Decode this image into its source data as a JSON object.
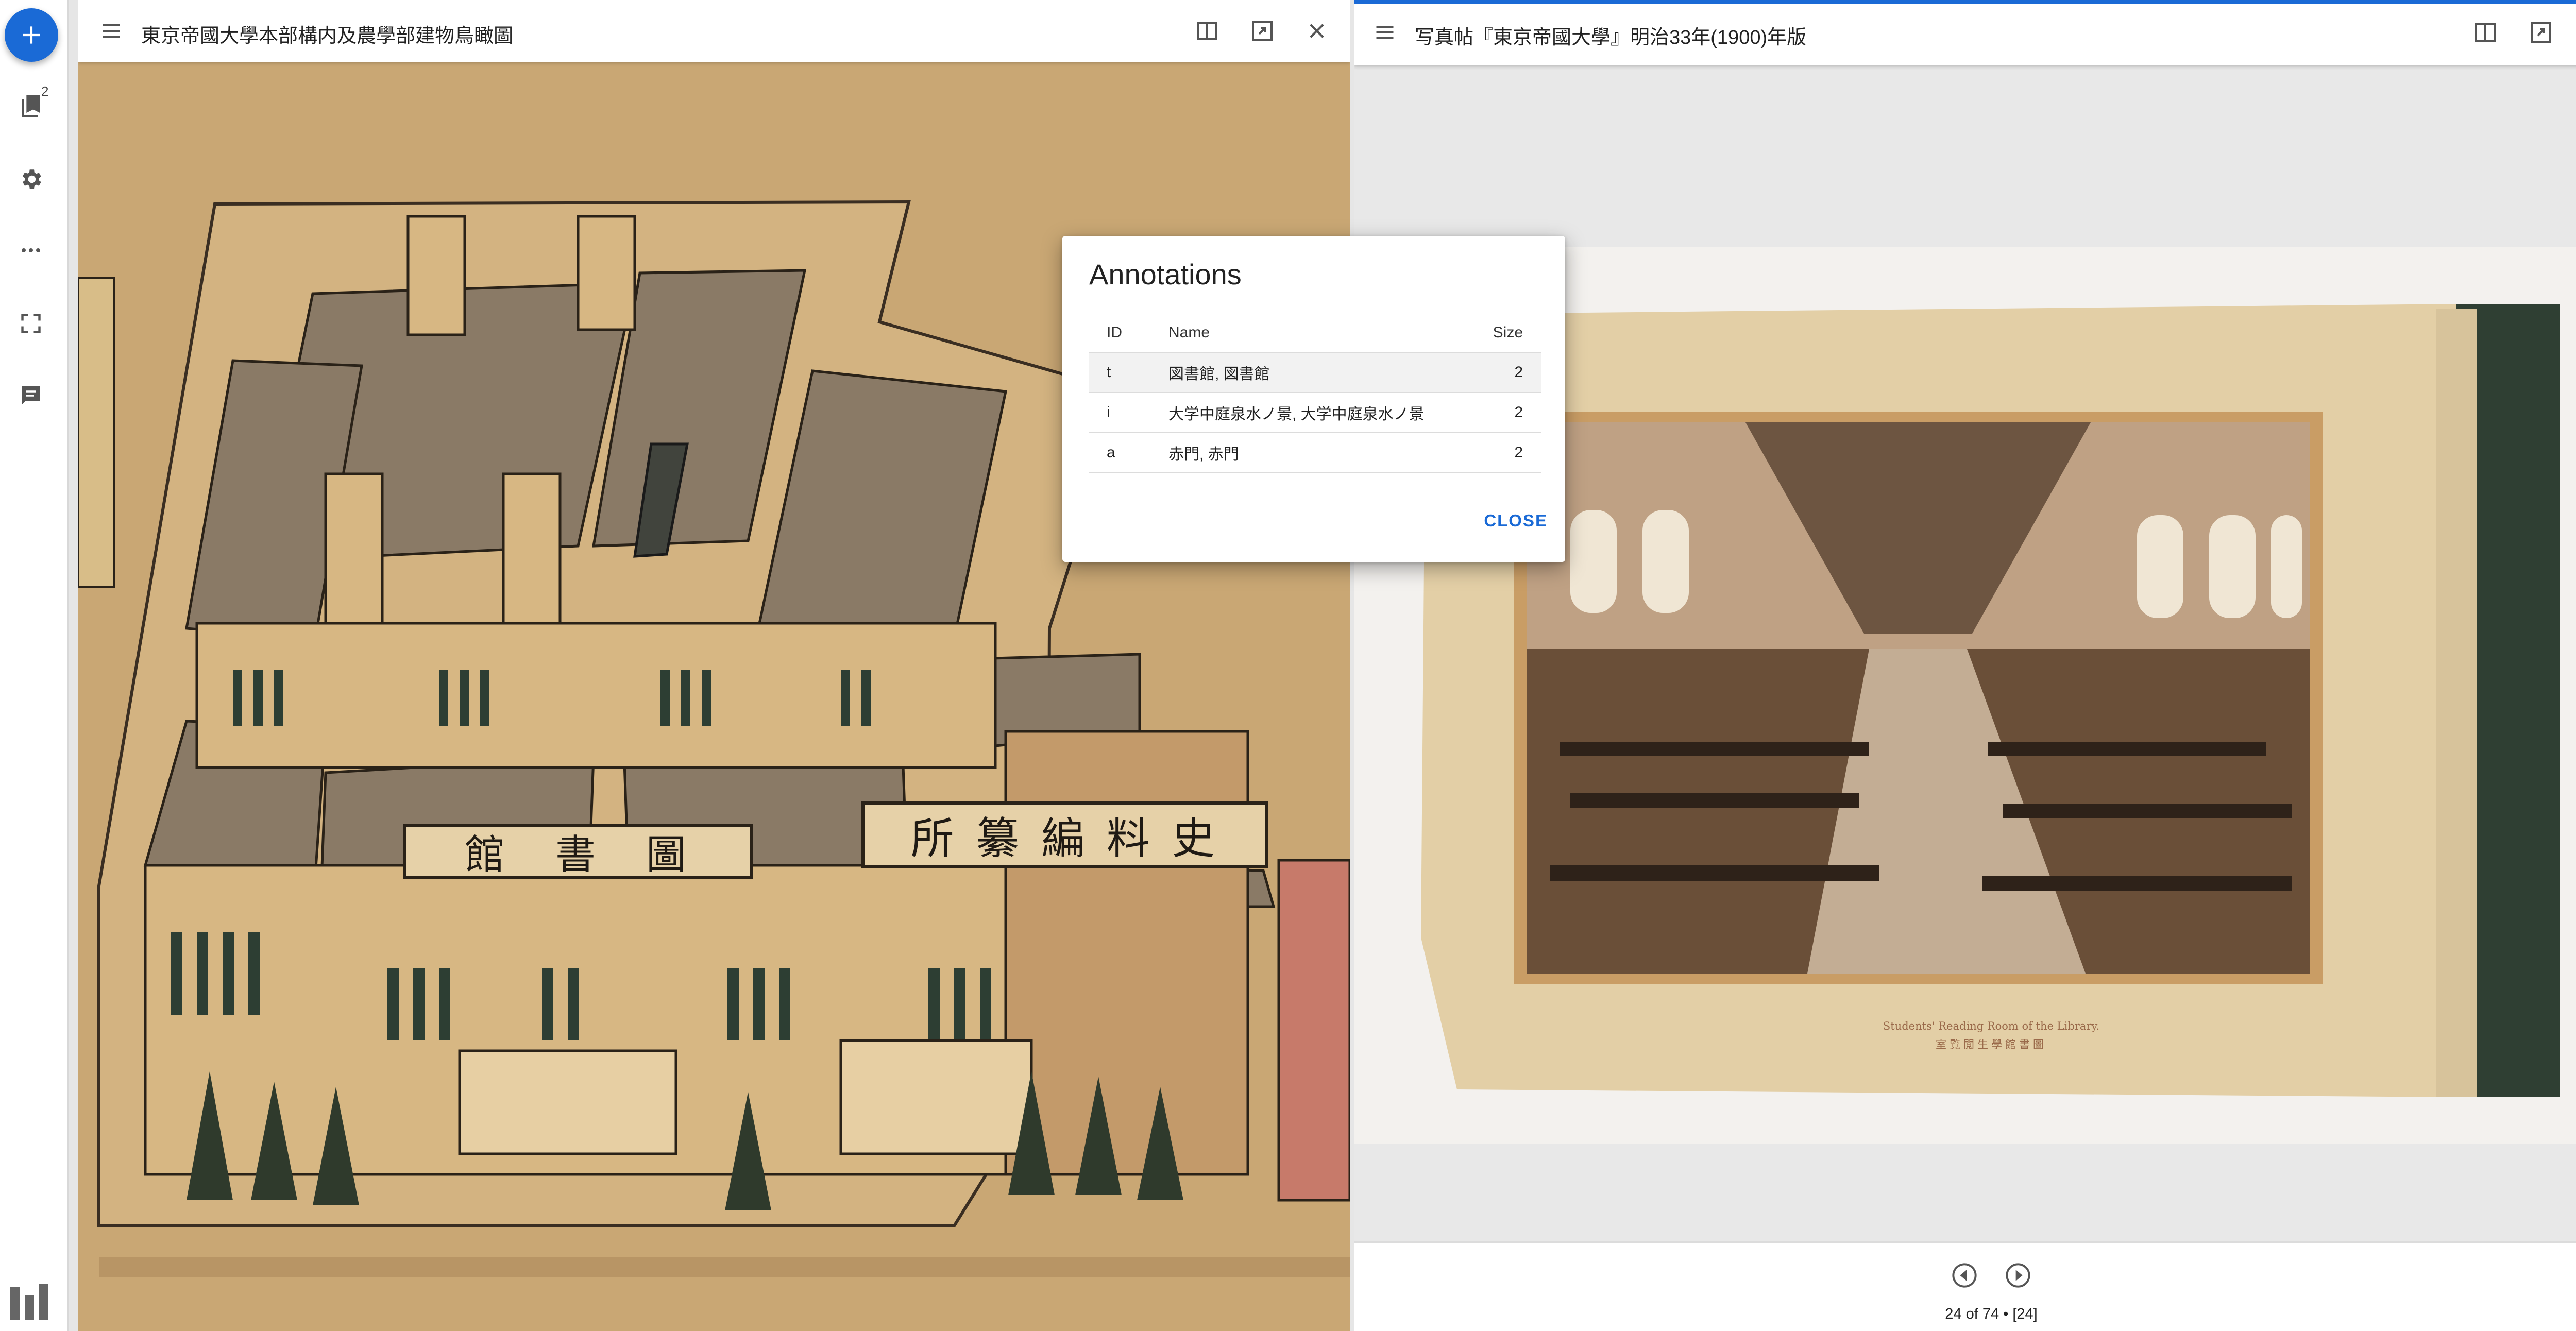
{
  "sidebar": {
    "add_icon": "plus-icon",
    "bookmarks_icon": "bookmark-icon",
    "bookmarks_badge": "2",
    "settings_icon": "gear-icon",
    "more_icon": "more-horizontal-icon",
    "fullscreen_icon": "fullscreen-icon",
    "annotations_icon": "comment-icon",
    "logo_icon": "mirador-logo-icon"
  },
  "windows": [
    {
      "title": "東京帝國大學本部構内及農學部建物鳥瞰圖",
      "map_signs": [
        "館　書　圖",
        "所 纂 編 料 史"
      ]
    },
    {
      "title": "写真帖『東京帝國大學』明治33年(1900)年版",
      "caption_en": "Students' Reading Room of the Library.",
      "caption_ja": "室覧閲生學館書圖",
      "page_label": "24 of 74 • [24]"
    }
  ],
  "dialog": {
    "title": "Annotations",
    "columns": [
      "ID",
      "Name",
      "Size"
    ],
    "rows": [
      {
        "id": "t",
        "name": "図書館, 図書館",
        "size": "2"
      },
      {
        "id": "i",
        "name": "大学中庭泉水ノ景, 大学中庭泉水ノ景",
        "size": "2"
      },
      {
        "id": "a",
        "name": "赤門, 赤門",
        "size": "2"
      }
    ],
    "close_label": "CLOSE"
  },
  "colors": {
    "accent": "#1a6ad6",
    "map_paper": "#c9a774",
    "photo_sepia": "#8a6a4a"
  }
}
